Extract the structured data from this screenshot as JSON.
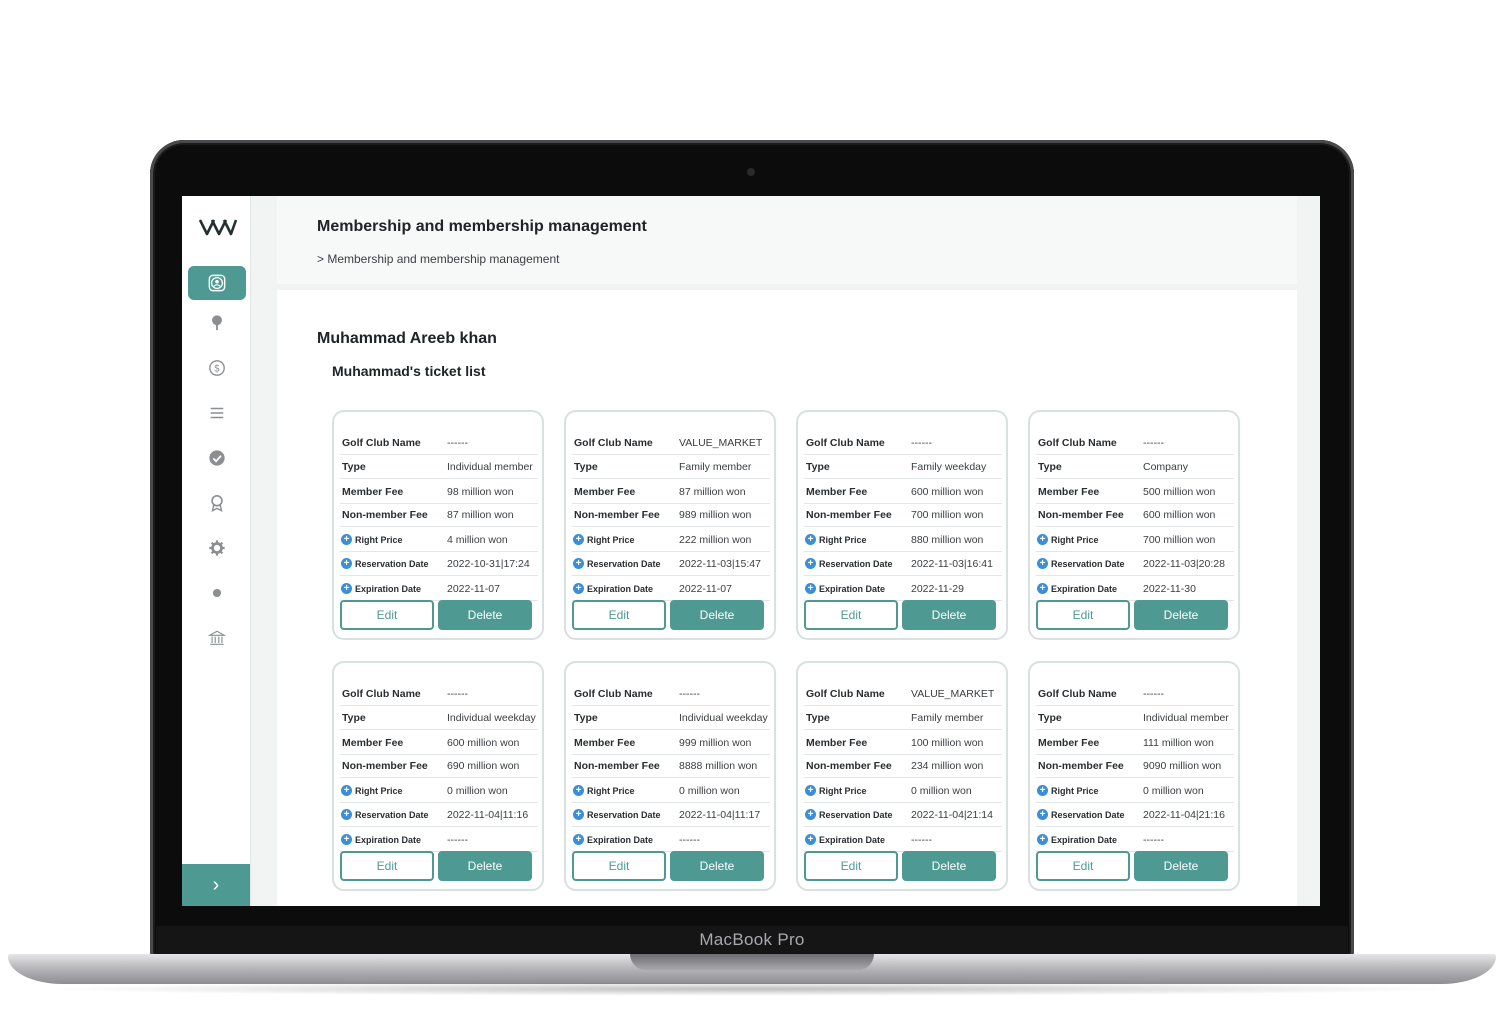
{
  "device": {
    "label": "MacBook Pro"
  },
  "sidebar": {
    "logo": "logo-icon",
    "items": [
      {
        "icon": "user-circle-icon",
        "active": true
      },
      {
        "icon": "golf-icon"
      },
      {
        "icon": "dollar-icon"
      },
      {
        "icon": "list-icon"
      },
      {
        "icon": "check-circle-icon"
      },
      {
        "icon": "award-icon"
      },
      {
        "icon": "gear-icon"
      },
      {
        "icon": "dot-icon"
      },
      {
        "icon": "bank-icon"
      }
    ],
    "expand_label": "›"
  },
  "header": {
    "title": "Membership and membership management",
    "breadcrumb": "> Membership and membership management"
  },
  "member": {
    "name": "Muhammad Areeb khan",
    "ticket_list_title": "Muhammad's ticket list"
  },
  "labels": {
    "golf_club_name": "Golf Club Name",
    "type": "Type",
    "member_fee": "Member Fee",
    "non_member_fee": "Non-member Fee",
    "right_price": "Right Price",
    "reservation_date": "Reservation Date",
    "expiration_date": "Expiration Date",
    "edit": "Edit",
    "delete": "Delete"
  },
  "tickets": [
    {
      "club": "------",
      "type": "Individual member",
      "member_fee": "98 million won",
      "non_member_fee": "87 million won",
      "right_price": "4 million won",
      "reservation": "2022-10-31|17:24",
      "expiration": "2022-11-07"
    },
    {
      "club": "VALUE_MARKET",
      "type": "Family member",
      "member_fee": "87 million won",
      "non_member_fee": "989 million won",
      "right_price": "222 million won",
      "reservation": "2022-11-03|15:47",
      "expiration": "2022-11-07"
    },
    {
      "club": "------",
      "type": "Family weekday",
      "member_fee": "600 million won",
      "non_member_fee": "700 million won",
      "right_price": "880 million won",
      "reservation": "2022-11-03|16:41",
      "expiration": "2022-11-29"
    },
    {
      "club": "------",
      "type": "Company",
      "member_fee": "500 million won",
      "non_member_fee": "600 million won",
      "right_price": "700 million won",
      "reservation": "2022-11-03|20:28",
      "expiration": "2022-11-30"
    },
    {
      "club": "------",
      "type": "Individual weekday",
      "member_fee": "600 million won",
      "non_member_fee": "690 million won",
      "right_price": "0 million won",
      "reservation": "2022-11-04|11:16",
      "expiration": "------"
    },
    {
      "club": "------",
      "type": "Individual weekday",
      "member_fee": "999 million won",
      "non_member_fee": "8888 million won",
      "right_price": "0 million won",
      "reservation": "2022-11-04|11:17",
      "expiration": "------"
    },
    {
      "club": "VALUE_MARKET",
      "type": "Family member",
      "member_fee": "100 million won",
      "non_member_fee": "234 million won",
      "right_price": "0 million won",
      "reservation": "2022-11-04|21:14",
      "expiration": "------"
    },
    {
      "club": "------",
      "type": "Individual member",
      "member_fee": "111 million won",
      "non_member_fee": "9090 million won",
      "right_price": "0 million won",
      "reservation": "2022-11-04|21:16",
      "expiration": "------"
    }
  ],
  "colors": {
    "accent": "#4e9a93",
    "info": "#3a8fd9"
  }
}
